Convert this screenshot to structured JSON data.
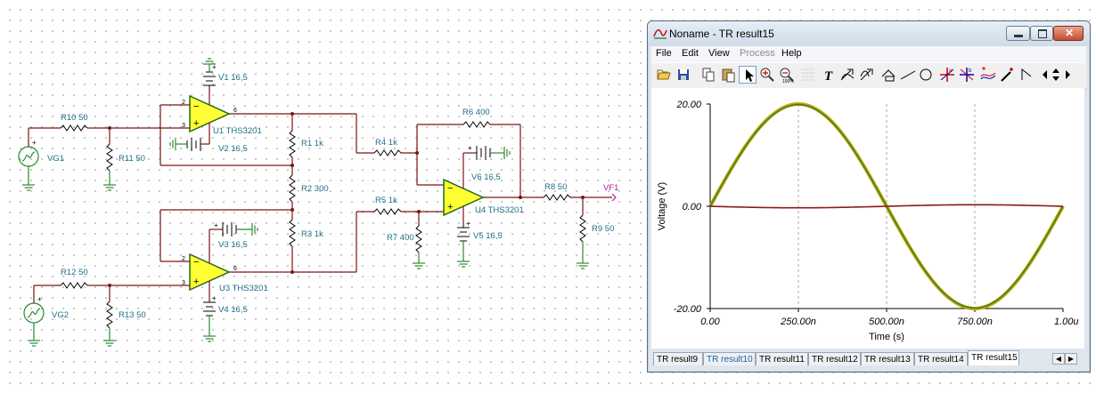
{
  "schematic": {
    "labels": {
      "r10": "R10 50",
      "r11": "R11 50",
      "vg1": "VG1",
      "v1": "V1 16,5",
      "u1": "U1 THS3201",
      "v2": "V2 16,5",
      "r1": "R1 1k",
      "r2": "R2 300",
      "r3": "R3 1k",
      "v3": "V3 16,5",
      "u3": "U3 THS3201",
      "v4": "V4 16,5",
      "r12": "R12 50",
      "r13": "R13 50",
      "vg2": "VG2",
      "r4": "R4 1k",
      "r6": "R6 400",
      "v6": "V6 16,5",
      "r5": "R5 1k",
      "r7": "R7 400",
      "u4": "U4 THS3201",
      "v5": "V5 16,5",
      "r8": "R8 50",
      "r9": "R9 50",
      "vf1": "VF1"
    },
    "pins": {
      "p2": "2",
      "p3": "3",
      "p6": "6"
    }
  },
  "window": {
    "title": "Noname - TR result15",
    "menu": [
      {
        "label": "File",
        "enabled": true
      },
      {
        "label": "Edit",
        "enabled": true
      },
      {
        "label": "View",
        "enabled": true
      },
      {
        "label": "Process",
        "enabled": false
      },
      {
        "label": "Help",
        "enabled": true
      }
    ],
    "toolbar_icons": [
      "open-folder-icon",
      "save-icon",
      "copy-icon",
      "paste-icon",
      "pointer-icon",
      "zoom-in-icon",
      "zoom-out-icon",
      "grid-icon",
      "text-icon",
      "line-edit-icon",
      "curve-edit-icon",
      "axis-icon",
      "draw-line-icon",
      "draw-circle-icon",
      "cursor-a-icon",
      "cursor-b-icon",
      "add-curve-icon",
      "add-marker-icon",
      "slope-icon",
      "scroll-left-icon",
      "scroll-vertical-icon",
      "scroll-right-icon"
    ],
    "tabs": [
      {
        "label": "TR result9",
        "active": false,
        "highlight": false
      },
      {
        "label": "TR result10",
        "active": false,
        "highlight": true
      },
      {
        "label": "TR result11",
        "active": false,
        "highlight": false
      },
      {
        "label": "TR result12",
        "active": false,
        "highlight": false
      },
      {
        "label": "TR result13",
        "active": false,
        "highlight": false
      },
      {
        "label": "TR result14",
        "active": false,
        "highlight": false
      },
      {
        "label": "TR result15",
        "active": true,
        "highlight": false
      }
    ]
  },
  "chart_data": {
    "type": "line",
    "title": "",
    "xlabel": "Time (s)",
    "ylabel": "Voltage (V)",
    "xlim": [
      0,
      1
    ],
    "ylim": [
      -20,
      20
    ],
    "x_ticks": [
      "0.00",
      "250.00n",
      "500.00n",
      "750.00n",
      "1.00u"
    ],
    "y_ticks": [
      "20.00",
      "0.00",
      "-20.00"
    ],
    "grid": "vertical dashed",
    "x_unit": "µs",
    "x": [
      0,
      0.125,
      0.25,
      0.375,
      0.5,
      0.625,
      0.75,
      0.875,
      1.0
    ],
    "series": [
      {
        "color": "#d4a200",
        "values": [
          0,
          14.14,
          20,
          14.14,
          0,
          -14.14,
          -20,
          -14.14,
          0
        ]
      },
      {
        "color": "#2e8b2e",
        "values": [
          0,
          14.1,
          19.9,
          14.1,
          0,
          -14.1,
          -19.9,
          -14.1,
          0
        ]
      },
      {
        "color": "#8b1a1a",
        "values": [
          0,
          -0.2,
          -0.3,
          -0.2,
          0,
          0.2,
          0.3,
          0.2,
          0
        ]
      }
    ]
  }
}
